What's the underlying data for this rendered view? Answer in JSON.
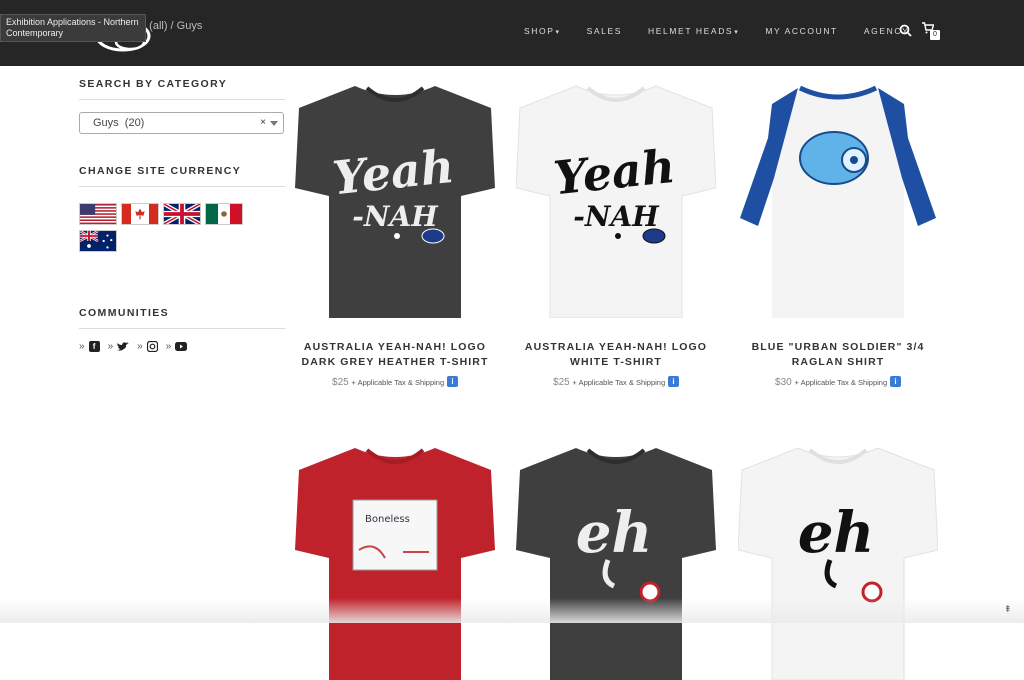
{
  "tooltip": "Exhibition Applications - Northern Contemporary",
  "breadcrumb": "g (all) / Guys",
  "nav": {
    "items": [
      "SHOP",
      "SALES",
      "HELMET HEADS",
      "MY ACCOUNT",
      "AGENCY"
    ],
    "cart_count": "0"
  },
  "sidebar": {
    "category_heading": "SEARCH BY CATEGORY",
    "category_value": "Guys  (20)",
    "clear": "×",
    "currency_heading": "CHANGE SITE CURRENCY",
    "communities_heading": "COMMUNITIES",
    "bullet": "»"
  },
  "products": [
    {
      "title": "AUSTRALIA YEAH-NAH! LOGO DARK GREY HEATHER T-SHIRT",
      "price": "$25",
      "tax": "+ Applicable Tax & Shipping"
    },
    {
      "title": "AUSTRALIA YEAH-NAH! LOGO WHITE T-SHIRT",
      "price": "$25",
      "tax": "+ Applicable Tax & Shipping"
    },
    {
      "title": "BLUE \"URBAN SOLDIER\" 3/4 RAGLAN SHIRT",
      "price": "$30",
      "tax": "+ Applicable Tax & Shipping"
    }
  ],
  "artwork": {
    "yeah_top": "Yeah",
    "yeah_bottom": "-NAH",
    "eh": "eh",
    "boneless": "Boneless"
  },
  "scroll_top": "⇞",
  "colors": {
    "topbar": "#262626",
    "info": "#3a7bd5",
    "dark_shirt": "#3f3f3f",
    "red_shirt": "#c0222b",
    "raglan_blue": "#1e4fa3"
  }
}
